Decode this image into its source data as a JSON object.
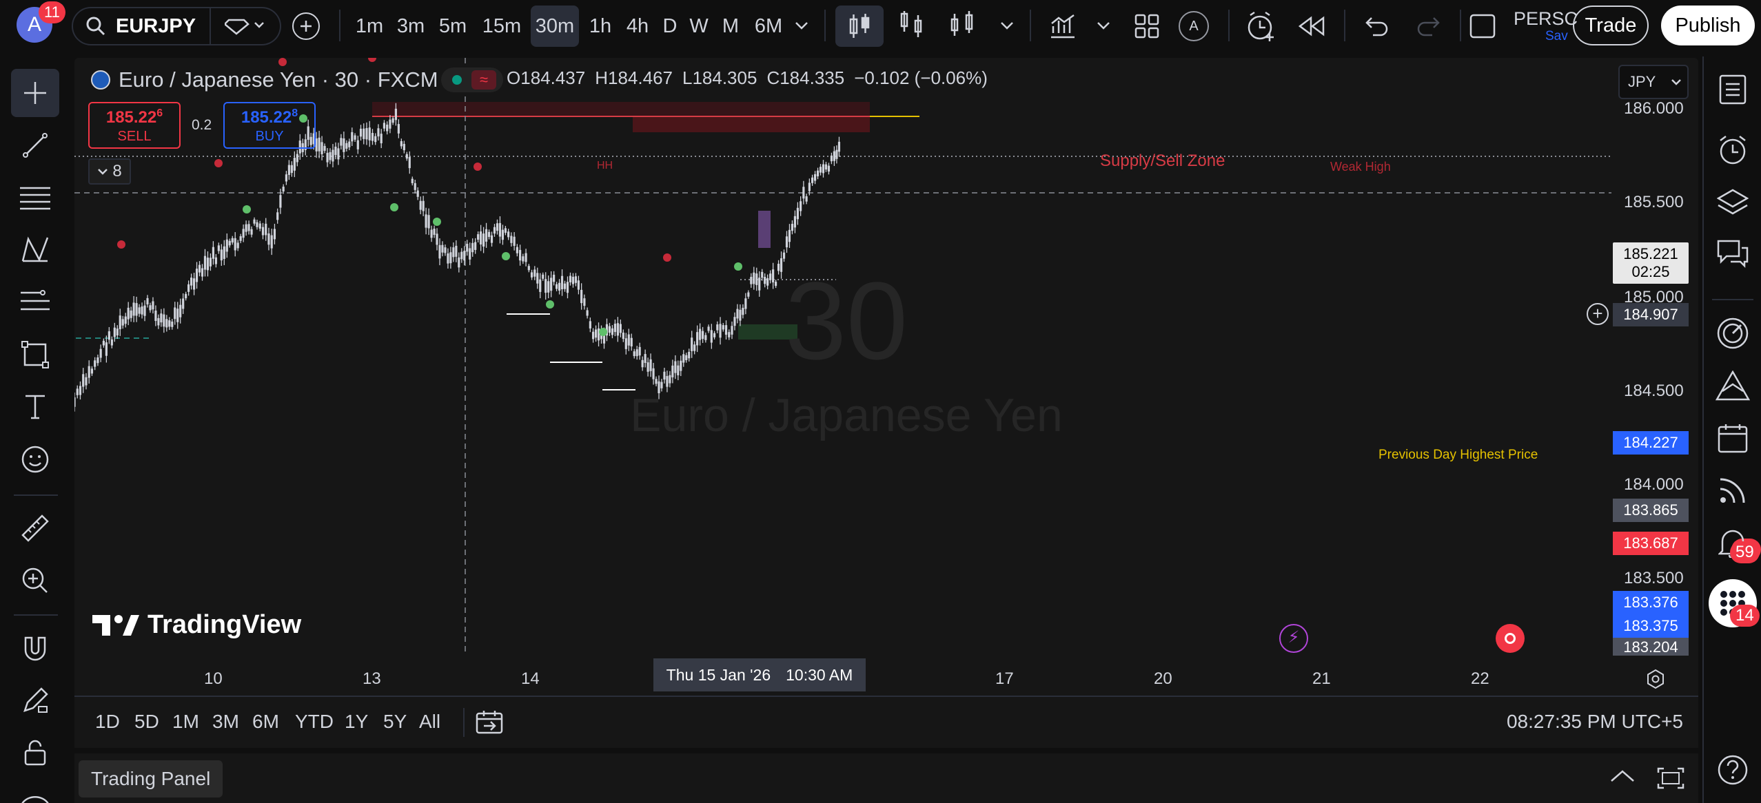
{
  "app": {
    "accent": "#2962ff",
    "bg": "#0f0f0f"
  },
  "topbar": {
    "avatar_letter": "A",
    "notif_count": "11",
    "symbol": "EURJPY",
    "timeframes": [
      "1m",
      "3m",
      "5m",
      "15m",
      "30m",
      "1h",
      "4h",
      "D",
      "W",
      "M",
      "6M"
    ],
    "active_timeframe": "30m",
    "auto_label": "A",
    "account_label": "PERSC",
    "save_label": "Sav",
    "trade_label": "Trade",
    "publish_label": "Publish"
  },
  "legend": {
    "title": "Euro / Japanese Yen · 30 · FXCM",
    "o_label": "O",
    "o": "184.437",
    "h_label": "H",
    "h": "184.467",
    "l_label": "L",
    "l": "184.305",
    "c_label": "C",
    "c": "184.335",
    "change": "−0.102 (−0.06%)",
    "sell_price": "185.22",
    "sell_sup": "6",
    "sell_label": "SELL",
    "spread": "0.2",
    "buy_price": "185.22",
    "buy_sup": "8",
    "buy_label": "BUY",
    "indicators_count": "8"
  },
  "currency_select": "JPY",
  "watermark": {
    "interval": "30",
    "name": "Euro / Japanese Yen"
  },
  "brand": "TradingView",
  "chart": {
    "annotations": {
      "hh": "HH",
      "supply": "Supply/Sell Zone",
      "weak_high": "Weak High",
      "prev_day": "Previous Day Highest Price"
    },
    "price_axis": [
      "186.000",
      "185.500",
      "185.000",
      "184.500",
      "184.000",
      "183.500"
    ],
    "price_tags": {
      "last": "185.221",
      "countdown": "02:25",
      "crosshair": "184.907",
      "blue1": "184.227",
      "gray1": "183.865",
      "red1": "183.687",
      "blue2": "183.376",
      "blue3": "183.375",
      "gray2": "183.204"
    },
    "time_axis": [
      "10",
      "13",
      "14",
      "17",
      "20",
      "21",
      "22"
    ],
    "crosshair_time": "Thu 15 Jan '26",
    "crosshair_clock": "10:30 AM"
  },
  "bottom": {
    "ranges": [
      "1D",
      "5D",
      "1M",
      "3M",
      "6M",
      "YTD",
      "1Y",
      "5Y",
      "All"
    ],
    "clock": "08:27:35 PM UTC+5",
    "panel_label": "Trading Panel"
  },
  "right_badges": {
    "ideas": "59",
    "alerts": "14"
  },
  "colors": {
    "up": "#26a69a",
    "down": "#f23645",
    "candle": "#d1d4dc",
    "blue_tag": "#2962ff",
    "red_tag": "#f23645",
    "yellow": "#e5c100"
  }
}
